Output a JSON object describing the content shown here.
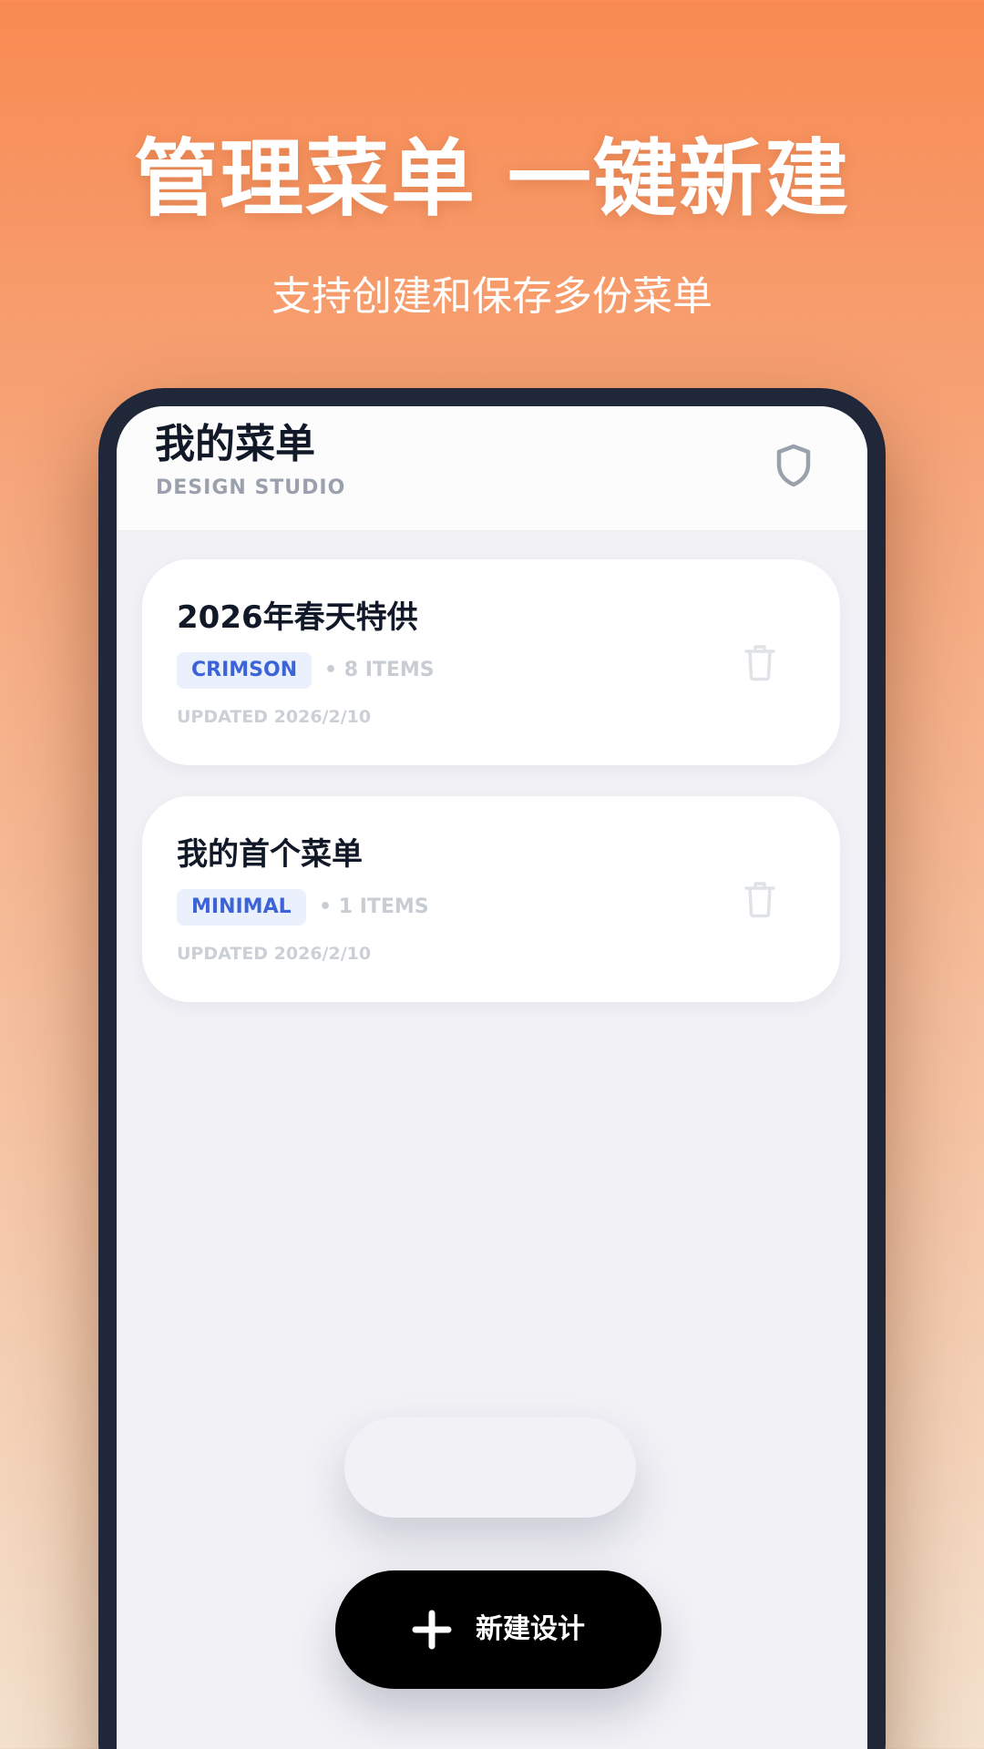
{
  "hero": {
    "title": "管理菜单 一键新建",
    "subtitle": "支持创建和保存多份菜单"
  },
  "app": {
    "header": {
      "title": "我的菜单",
      "subtitle": "DESIGN STUDIO",
      "shield_icon": "shield-icon"
    },
    "menus": [
      {
        "title": "2026年春天特供",
        "theme": "CRIMSON",
        "items": "• 8 ITEMS",
        "updated": "UPDATED 2026/2/10",
        "action_icon": "trash-icon"
      },
      {
        "title": "我的首个菜单",
        "theme": "MINIMAL",
        "items": "• 1 ITEMS",
        "updated": "UPDATED 2026/2/10",
        "action_icon": "trash-icon"
      }
    ],
    "fab": {
      "label": "新建设计",
      "icon": "plus-icon"
    }
  },
  "colors": {
    "background_top": "#f88a52",
    "background_bottom": "#f3e1cd",
    "phone_frame": "#1f2738",
    "screen_bg": "#f1f1f6",
    "tag_bg": "#eaf1fd",
    "tag_text": "#3c63d8",
    "fab_bg": "#000000"
  }
}
